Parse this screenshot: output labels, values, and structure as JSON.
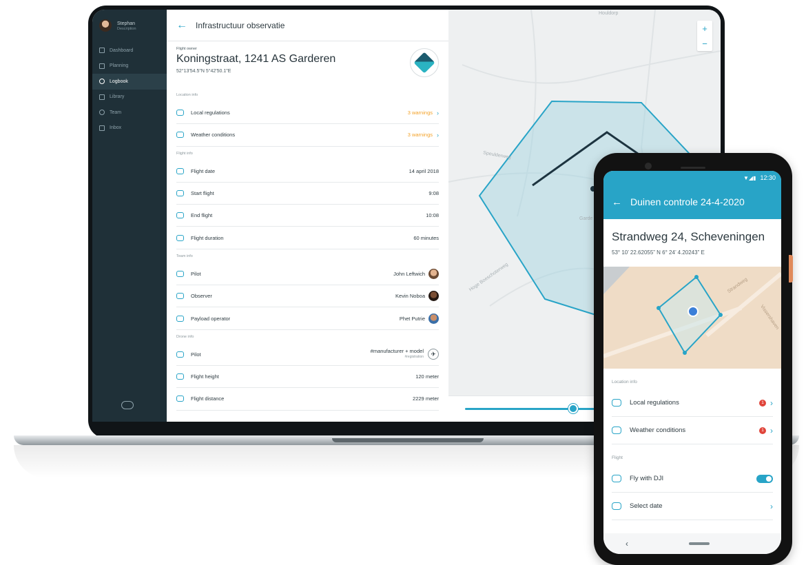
{
  "laptop": {
    "user": {
      "name": "Stephan",
      "description": "Description"
    },
    "nav": [
      {
        "label": "Dashboard",
        "icon": "dashboard-icon",
        "active": false
      },
      {
        "label": "Planning",
        "icon": "planning-icon",
        "active": false
      },
      {
        "label": "Logbook",
        "icon": "logbook-icon",
        "active": true
      },
      {
        "label": "Library",
        "icon": "library-icon",
        "active": false
      },
      {
        "label": "Team",
        "icon": "team-icon",
        "active": false
      },
      {
        "label": "Inbox",
        "icon": "inbox-icon",
        "active": false
      }
    ],
    "header": {
      "title": "Infrastructuur observatie"
    },
    "owner": {
      "label": "Flight owner",
      "address": "Koningstraat, 1241 AS Garderen",
      "coords": "52°13'54.5\"N 5°42'50.1\"E"
    },
    "location_info": {
      "label": "Location info",
      "rows": [
        {
          "label": "Local regulations",
          "value": "3 warnings",
          "icon": "regulations-icon"
        },
        {
          "label": "Weather conditions",
          "value": "3 warnings",
          "icon": "weather-icon"
        }
      ]
    },
    "flight_info": {
      "label": "Flight info",
      "rows": [
        {
          "label": "Flight date",
          "value": "14 april 2018",
          "icon": "calendar-icon"
        },
        {
          "label": "Start flight",
          "value": "9:08",
          "icon": "start-icon"
        },
        {
          "label": "End flight",
          "value": "10:08",
          "icon": "end-icon"
        },
        {
          "label": "Flight duration",
          "value": "60 minutes",
          "icon": "duration-icon"
        }
      ]
    },
    "team_info": {
      "label": "Team info",
      "rows": [
        {
          "label": "Pilot",
          "value": "John Leftwich",
          "icon": "pilot-icon"
        },
        {
          "label": "Observer",
          "value": "Kevin Noboa",
          "icon": "observer-icon"
        },
        {
          "label": "Payload operator",
          "value": "Phet Putrie",
          "icon": "payload-icon"
        }
      ]
    },
    "drone_info": {
      "label": "Drone info",
      "rows": [
        {
          "label": "Pilot",
          "value": "#manufacturer + model",
          "sub": "#registration",
          "icon": "drone-icon"
        },
        {
          "label": "Flight height",
          "value": "120 meter",
          "icon": "height-icon"
        },
        {
          "label": "Flight distance",
          "value": "2229 meter",
          "icon": "distance-icon"
        }
      ]
    },
    "map": {
      "zoom_in": "+",
      "zoom_out": "−",
      "labels": [
        "Houldorp",
        "Speulderweg",
        "Garde",
        "Hoge Boeschoterweg"
      ]
    },
    "colors": {
      "accent": "#28a4c7",
      "sidebar": "#1f3038",
      "warning": "#f3a229"
    }
  },
  "phone": {
    "status_time": "12:30",
    "appbar_title": "Duinen controle 24-4-2020",
    "address": "Strandweg 24, Scheveningen",
    "coords": "53° 10’ 22.62055” N 6° 24’ 4.20243” E",
    "map_labels": [
      "Strandweg",
      "Vissershaven"
    ],
    "location_info": {
      "label": "Location info",
      "rows": [
        {
          "label": "Local regulations",
          "badge": "1",
          "icon": "regulations-icon"
        },
        {
          "label": "Weather conditions",
          "badge": "1",
          "icon": "weather-icon"
        }
      ]
    },
    "flight": {
      "label": "Flight",
      "rows": [
        {
          "label": "Fly with DJI",
          "toggle": true,
          "icon": "link-icon"
        },
        {
          "label": "Select date",
          "icon": "calendar-icon"
        }
      ]
    },
    "colors": {
      "appbar": "#28a4c7",
      "badge": "#e0443a"
    }
  }
}
